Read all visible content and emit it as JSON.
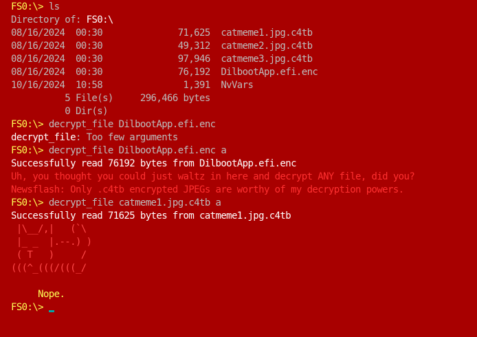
{
  "terminal": {
    "prompt": "FS0:\\>",
    "lines": [
      {
        "type": "cmd",
        "text": " ls"
      },
      {
        "type": "mixed",
        "a": "Directory of: ",
        "b": "FS0:\\"
      },
      {
        "type": "gray",
        "text": "08/16/2024  00:30              71,625  catmeme1.jpg.c4tb"
      },
      {
        "type": "gray",
        "text": "08/16/2024  00:30              49,312  catmeme2.jpg.c4tb"
      },
      {
        "type": "gray",
        "text": "08/16/2024  00:30              97,946  catmeme3.jpg.c4tb"
      },
      {
        "type": "gray",
        "text": "08/16/2024  00:30              76,192  DilbootApp.efi.enc"
      },
      {
        "type": "gray",
        "text": "10/16/2024  10:58               1,391  NvVars"
      },
      {
        "type": "gray",
        "text": "          5 File(s)     296,466 bytes"
      },
      {
        "type": "gray",
        "text": "          0 Dir(s)"
      },
      {
        "type": "cmd",
        "text": " decrypt_file DilbootApp.efi.enc"
      },
      {
        "type": "mixed2",
        "a": "decrypt_file",
        "b": ": Too few arguments"
      },
      {
        "type": "cmd",
        "text": " decrypt_file DilbootApp.efi.enc a"
      },
      {
        "type": "white",
        "text": "Successfully read 76192 bytes from DilbootApp.efi.enc"
      },
      {
        "type": "dark",
        "text": "Uh, you thought you could just waltz in here and decrypt ANY file, did you?"
      },
      {
        "type": "dark",
        "text": "Newsflash: Only .c4tb encrypted JPEGs are worthy of my decryption powers."
      },
      {
        "type": "cmd",
        "text": " decrypt_file catmeme1.jpg.c4tb a"
      },
      {
        "type": "white",
        "text": "Successfully read 71625 bytes from catmeme1.jpg.c4tb"
      },
      {
        "type": "cat",
        "text": " |\\__/,|   (`\\"
      },
      {
        "type": "cat",
        "text": " |_ _  |.--.) )"
      },
      {
        "type": "cat",
        "text": " ( T   )     /"
      },
      {
        "type": "cat",
        "text": "(((^_(((/(((_/"
      },
      {
        "type": "blank",
        "text": ""
      },
      {
        "type": "nope",
        "text": "     Nope."
      },
      {
        "type": "cmd",
        "text": " "
      }
    ]
  },
  "colors": {
    "background": "#a80000",
    "prompt": "#ffff55",
    "text": "#bdbdbd",
    "bright": "#ffffff",
    "error": "#ff3030",
    "cursor": "#00a8a8"
  }
}
